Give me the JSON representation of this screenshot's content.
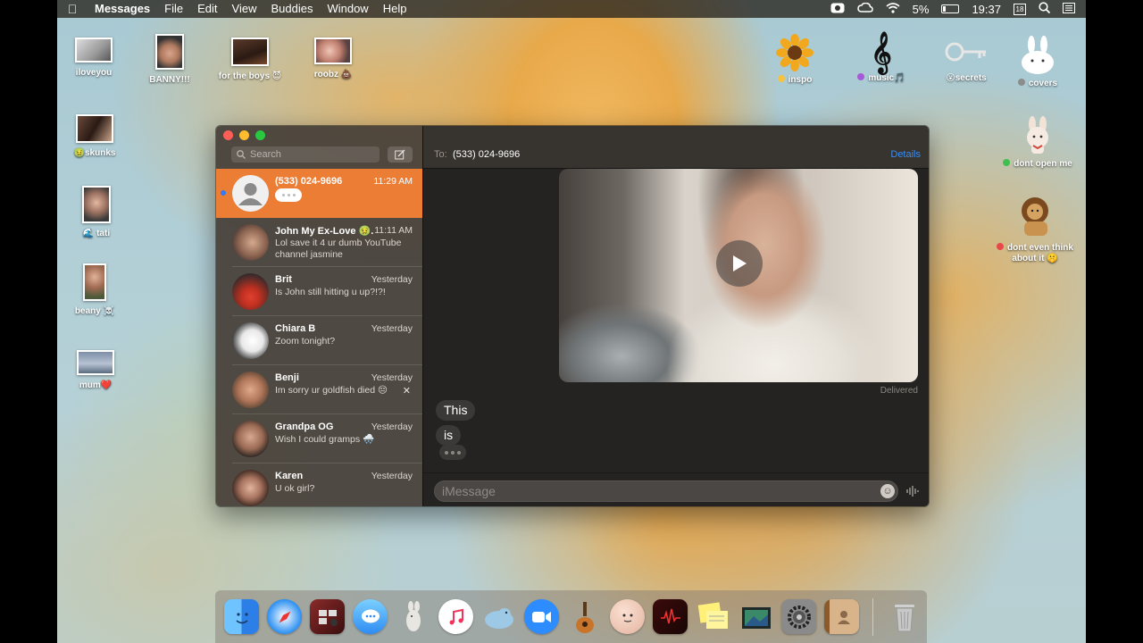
{
  "menubar": {
    "app_name": "Messages",
    "menus": [
      "File",
      "Edit",
      "View",
      "Buddies",
      "Window",
      "Help"
    ],
    "battery": "5%",
    "clock": "19:37",
    "calendar_day": "18"
  },
  "desktop": {
    "icons": [
      {
        "label": "iloveyou"
      },
      {
        "label": "BANNY!!!"
      },
      {
        "label": "for the boys 😈"
      },
      {
        "label": "roobz 💩"
      },
      {
        "label": "🤢skunks"
      },
      {
        "label": "🌊 tati"
      },
      {
        "label": "beany ☠️"
      },
      {
        "label": "mum❤️"
      },
      {
        "label": "inspo",
        "tag_color": "#f5c242"
      },
      {
        "label": "music🎵",
        "tag_color": "#a65bd6"
      },
      {
        "label": "😮secrets"
      },
      {
        "label": "covers",
        "tag_color": "#8c8c8c"
      },
      {
        "label": "dont open me",
        "tag_color": "#3fbf4f"
      },
      {
        "label": "dont even think about it 🤫",
        "tag_color": "#e84848"
      }
    ]
  },
  "messages_window": {
    "search_placeholder": "Search",
    "compose_icon": "compose-icon",
    "conversations": [
      {
        "name": "(533) 024-9696",
        "time": "11:29 AM",
        "preview": "",
        "active": true,
        "unread": true,
        "typing": true
      },
      {
        "name": "John My Ex-Love 🤢...",
        "time": "11:11 AM",
        "preview": "Lol save it 4 ur dumb YouTube channel jasmine"
      },
      {
        "name": "Brit",
        "time": "Yesterday",
        "preview": "Is John still hitting u up?!?!"
      },
      {
        "name": "Chiara B",
        "time": "Yesterday",
        "preview": "Zoom tonight?"
      },
      {
        "name": "Benji",
        "time": "Yesterday",
        "preview": "Im sorry ur goldfish died 😔",
        "show_delete": true
      },
      {
        "name": "Grandpa OG",
        "time": "Yesterday",
        "preview": "Wish I could gramps 🌨️"
      },
      {
        "name": "Karen",
        "time": "Yesterday",
        "preview": "U ok girl?"
      }
    ],
    "header": {
      "to_label": "To:",
      "recipient": "(533) 024-9696",
      "details": "Details"
    },
    "thread": {
      "delivered": "Delivered",
      "incoming": [
        "This",
        "is"
      ],
      "typing_indicator": true
    },
    "composer": {
      "placeholder": "iMessage"
    }
  },
  "dock": {
    "apps": [
      "Finder",
      "Safari",
      "Photo Booth",
      "Messages",
      "Hamster",
      "Music",
      "Seal",
      "Zoom",
      "GarageBand",
      "Face",
      "Photo Booth Video",
      "Stickies",
      "Preview",
      "System Preferences",
      "Contacts",
      "Trash"
    ]
  }
}
